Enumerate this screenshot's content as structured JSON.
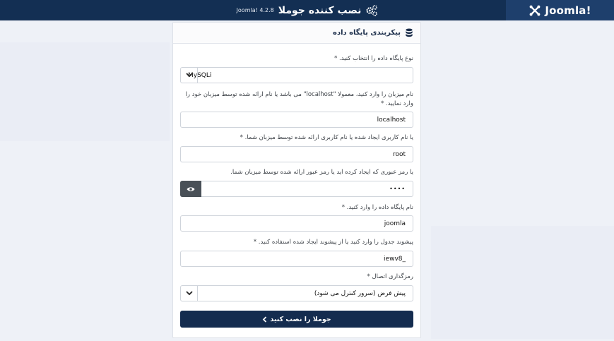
{
  "header": {
    "brand": "Joomla!",
    "title": "نصب کننده جوملا",
    "version": "Joomla! 4.2.8"
  },
  "card": {
    "title": "پیکربندی پایگاه داده",
    "fields": {
      "db_type": {
        "label": "نوع پایگاه داده را انتخاب کنید. *",
        "value": "MySQLi"
      },
      "host": {
        "label": "نام میزبان را وارد کنید، معمولا \"localhost\" می باشد یا نام ارائه شده توسط میزبان خود را وارد نمایید. *",
        "value": "localhost"
      },
      "username": {
        "label": "یا نام کاربری ایجاد شده یا نام کاربری ارائه شده توسط میزبان شما. *",
        "value": "root"
      },
      "password": {
        "label": "یا رمز عبوری که ایجاد کرده اید یا رمز عبور ارائه شده توسط میزبان شما.",
        "value": "••••"
      },
      "db_name": {
        "label": "نام پایگاه داده را وارد کنید. *",
        "value": "joomla"
      },
      "prefix": {
        "label": "پیشوند جدول را وارد کنید یا از پیشوند ایجاد شده استفاده کنید. *",
        "value": "iewv8_"
      },
      "encryption": {
        "label": "رمزگذاری اتصال *",
        "value": "پیش فرض (سرور کنترل می شود)"
      }
    },
    "submit_label": "جوملا را نصب کنید"
  },
  "colors": {
    "header_bg": "#132f53",
    "brand_bg": "#1e3f6c",
    "button_bg": "#142c4f",
    "page_bg": "#eef1f7"
  }
}
